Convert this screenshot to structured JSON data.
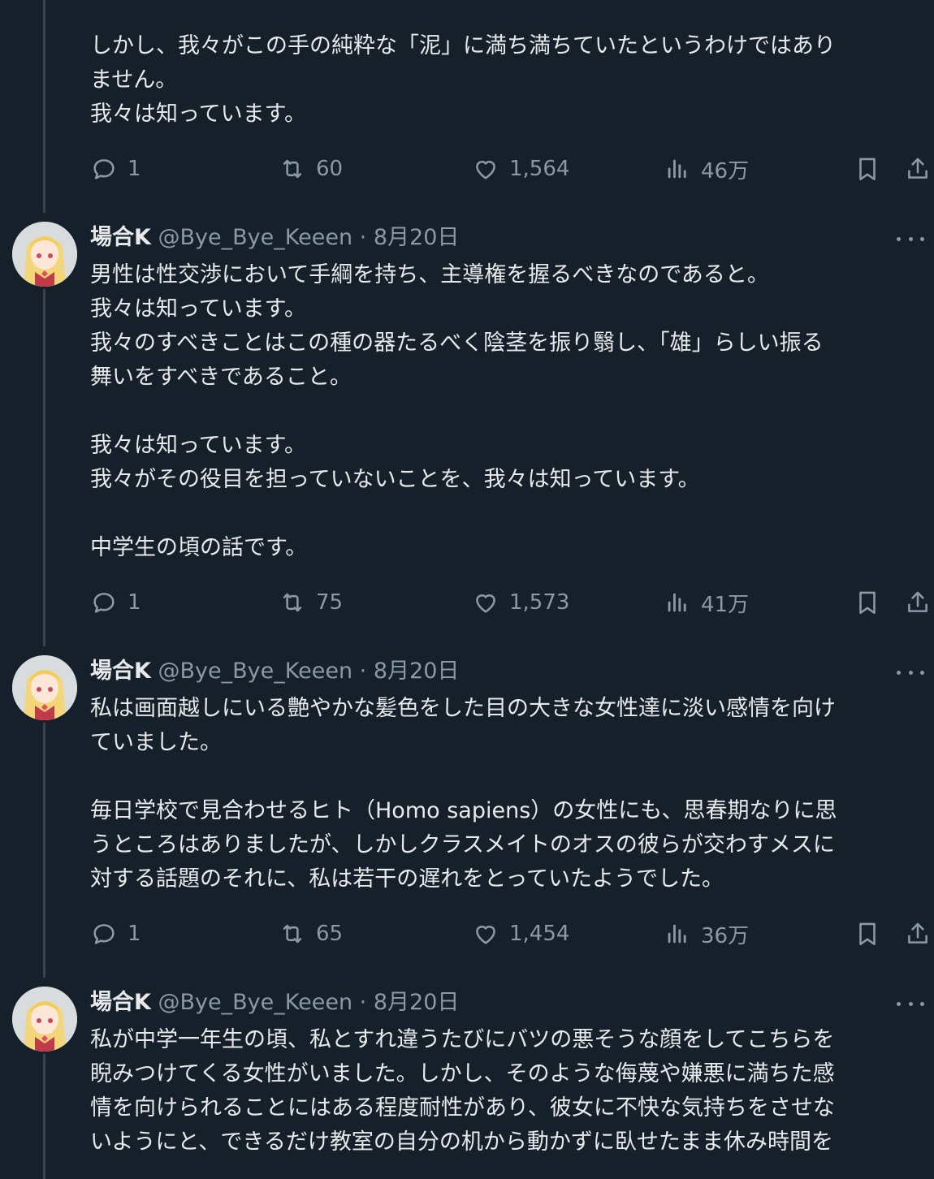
{
  "author": {
    "name": "場合K",
    "handle": "@Bye_Bye_Keeen",
    "separator": "·"
  },
  "icons": {
    "reply": "reply-icon",
    "retweet": "retweet-icon",
    "like": "heart-icon",
    "views": "views-icon",
    "bookmark": "bookmark-icon",
    "share": "share-icon",
    "more": "more-icon"
  },
  "tweets": [
    {
      "lines": [
        "しかし、我々がこの手の純粋な「泥」に満ち満ちていたというわけではあり",
        "ません。",
        "我々は知っています。"
      ],
      "stats": {
        "replies": "1",
        "retweets": "60",
        "likes": "1,564",
        "views": "46万"
      }
    },
    {
      "date": "8月20日",
      "lines": [
        "男性は性交渉において手綱を持ち、主導権を握るべきなのであると。",
        "我々は知っています。",
        "我々のすべきことはこの種の器たるべく陰茎を振り翳し、「雄」らしい振る",
        "舞いをすべきであること。",
        "",
        "我々は知っています。",
        "我々がその役目を担っていないことを、我々は知っています。",
        "",
        "中学生の頃の話です。"
      ],
      "stats": {
        "replies": "1",
        "retweets": "75",
        "likes": "1,573",
        "views": "41万"
      }
    },
    {
      "date": "8月20日",
      "lines": [
        "私は画面越しにいる艶やかな髪色をした目の大きな女性達に淡い感情を向け",
        "ていました。",
        "",
        "毎日学校で見合わせるヒト（Homo sapiens）の女性にも、思春期なりに思",
        "うところはありましたが、しかしクラスメイトのオスの彼らが交わすメスに",
        "対する話題のそれに、私は若干の遅れをとっていたようでした。"
      ],
      "stats": {
        "replies": "1",
        "retweets": "65",
        "likes": "1,454",
        "views": "36万"
      }
    },
    {
      "date": "8月20日",
      "lines": [
        "私が中学一年生の頃、私とすれ違うたびにバツの悪そうな顔をしてこちらを",
        "睨みつけてくる女性がいました。しかし、そのような侮蔑や嫌悪に満ちた感",
        "情を向けられることにはある程度耐性があり、彼女に不快な気持ちをさせな",
        "いようにと、できるだけ教室の自分の机から動かずに臥せたまま休み時間を"
      ]
    }
  ]
}
